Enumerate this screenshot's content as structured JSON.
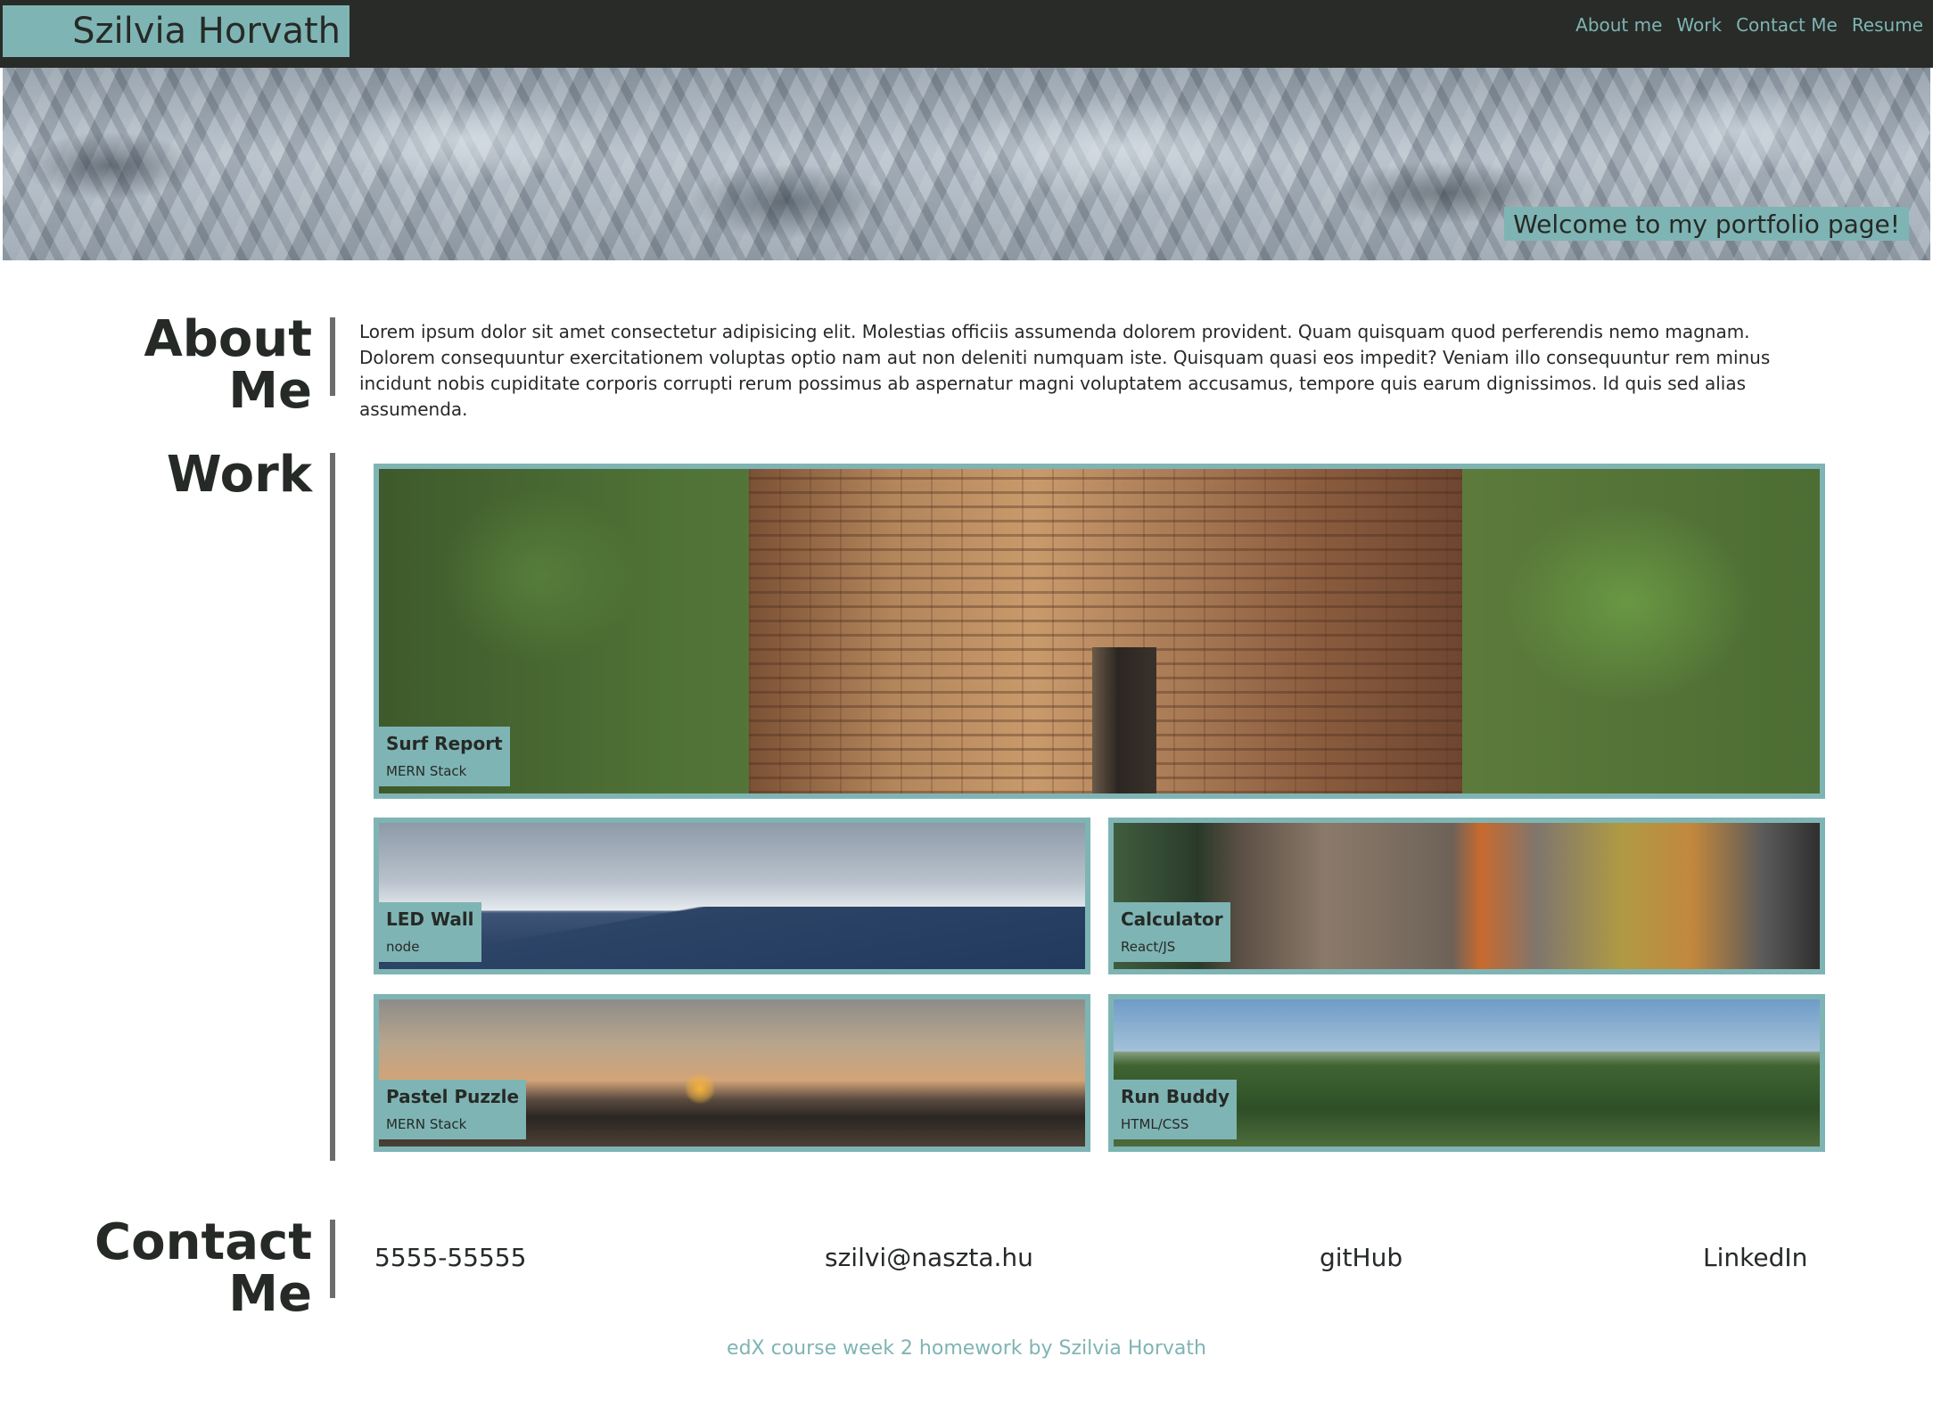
{
  "header": {
    "brand": "Szilvia Horvath",
    "nav": [
      "About me",
      "Work",
      "Contact Me",
      "Resume"
    ]
  },
  "hero": {
    "tagline": "Welcome to my portfolio page!"
  },
  "about": {
    "title_line1": "About",
    "title_line2": "Me",
    "text": "Lorem ipsum dolor sit amet consectetur adipisicing elit. Molestias officiis assumenda dolorem provident. Quam quisquam quod perferendis nemo magnam. Dolorem consequuntur exercitationem voluptas optio nam aut non deleniti numquam iste. Quisquam quasi eos impedit? Veniam illo consequuntur rem minus incidunt nobis cupiditate corporis corrupti rerum possimus ab aspernatur magni voluptatem accusamus, tempore quis earum dignissimos. Id quis sed alias assumenda."
  },
  "work": {
    "title": "Work",
    "projects": [
      {
        "title": "Surf Report",
        "stack": "MERN Stack"
      },
      {
        "title": "LED Wall",
        "stack": "node"
      },
      {
        "title": "Calculator",
        "stack": "React/JS"
      },
      {
        "title": "Pastel Puzzle",
        "stack": "MERN Stack"
      },
      {
        "title": "Run Buddy",
        "stack": "HTML/CSS"
      }
    ]
  },
  "contact": {
    "title_line1": "Contact",
    "title_line2": "Me",
    "phone": "5555-55555",
    "email": "szilvi@naszta.hu",
    "github": "gitHub",
    "linkedin": "LinkedIn"
  },
  "footer": {
    "text": "edX course week 2 homework by Szilvia Horvath"
  },
  "colors": {
    "accent": "#7fb4b4",
    "header_bg": "#282b27",
    "text": "#262a26",
    "rule": "#6c6c6c"
  }
}
